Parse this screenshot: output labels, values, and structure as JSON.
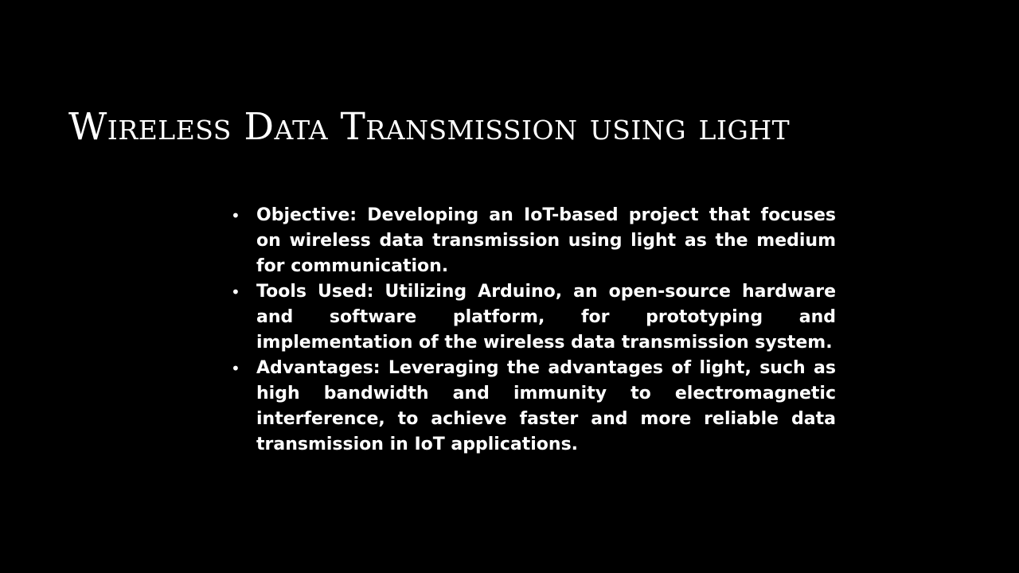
{
  "slide": {
    "background_color": "#000000",
    "text_color": "#ffffff",
    "title": "Wireless Data Transmission using light",
    "bullet_glyph": "•",
    "bullets": [
      {
        "text": "Objective: Developing an IoT-based project that focuses on wireless data transmission using light as the medium for communication."
      },
      {
        "text": "Tools Used: Utilizing Arduino, an open-source hardware and software platform, for prototyping and implementation of the wireless data transmission system."
      },
      {
        "text": "Advantages: Leveraging the advantages of light, such as high bandwidth and immunity to electromagnetic interference, to achieve faster and more reliable data transmission in IoT applications."
      }
    ]
  }
}
